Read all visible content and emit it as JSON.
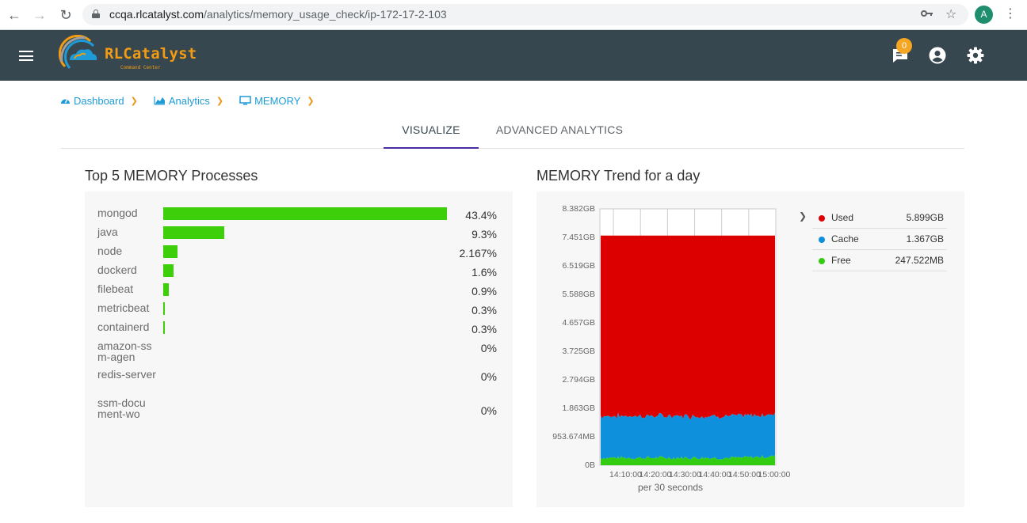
{
  "browser": {
    "url_host": "ccqa.rlcatalyst.com",
    "url_path": "/analytics/memory_usage_check/ip-172-17-2-103",
    "avatar_letter": "A"
  },
  "header": {
    "logo_title": "RLCatalyst",
    "logo_subtitle": "Command Center",
    "notification_count": "0"
  },
  "breadcrumb": {
    "items": [
      {
        "label": "Dashboard",
        "icon": "dashboard-icon"
      },
      {
        "label": "Analytics",
        "icon": "area-chart-icon"
      },
      {
        "label": "MEMORY",
        "icon": "monitor-icon"
      }
    ]
  },
  "tabs": {
    "visualize": "VISUALIZE",
    "advanced": "ADVANCED ANALYTICS",
    "active": "VISUALIZE"
  },
  "processes": {
    "title": "Top 5 MEMORY Processes",
    "bar_color": "#3ccf0a",
    "items": [
      {
        "name": "mongod",
        "value": "43.4%",
        "percent": 43.4
      },
      {
        "name": "java",
        "value": "9.3%",
        "percent": 9.3
      },
      {
        "name": "node",
        "value": "2.167%",
        "percent": 2.167
      },
      {
        "name": "dockerd",
        "value": "1.6%",
        "percent": 1.6
      },
      {
        "name": "filebeat",
        "value": "0.9%",
        "percent": 0.9
      },
      {
        "name": "metricbeat",
        "value": "0.3%",
        "percent": 0.3
      },
      {
        "name": "containerd",
        "value": "0.3%",
        "percent": 0.3
      },
      {
        "name": "amazon-ssm-agen",
        "value": "0%",
        "percent": 0
      },
      {
        "name": "redis-server",
        "value": "0%",
        "percent": 0
      },
      {
        "name": "ssm-document-wo",
        "value": "0%",
        "percent": 0
      }
    ]
  },
  "chart_data": {
    "type": "area",
    "title": "MEMORY Trend for a day",
    "xlabel": "per 30 seconds",
    "y_tick_labels": [
      "0B",
      "953.674MB",
      "1.863GB",
      "2.794GB",
      "3.725GB",
      "4.657GB",
      "5.588GB",
      "6.519GB",
      "7.451GB",
      "8.382GB"
    ],
    "x_tick_labels": [
      "14:10:00",
      "14:20:00",
      "14:30:00",
      "14:40:00",
      "14:50:00",
      "15:00:00"
    ],
    "ylim_gb": [
      0,
      8.382
    ],
    "stacked": true,
    "series": [
      {
        "name": "Free",
        "color": "#33cc11",
        "approx_gb": 0.2417
      },
      {
        "name": "Cache",
        "color": "#0e90dd",
        "approx_gb": 1.367
      },
      {
        "name": "Used",
        "color": "#dd0000",
        "approx_gb": 5.899
      }
    ],
    "legend": {
      "placement": "right",
      "items": [
        {
          "name": "Used",
          "value": "5.899GB",
          "color": "#dd0000"
        },
        {
          "name": "Cache",
          "value": "1.367GB",
          "color": "#0e90dd"
        },
        {
          "name": "Free",
          "value": "247.522MB",
          "color": "#33cc11"
        }
      ]
    }
  }
}
